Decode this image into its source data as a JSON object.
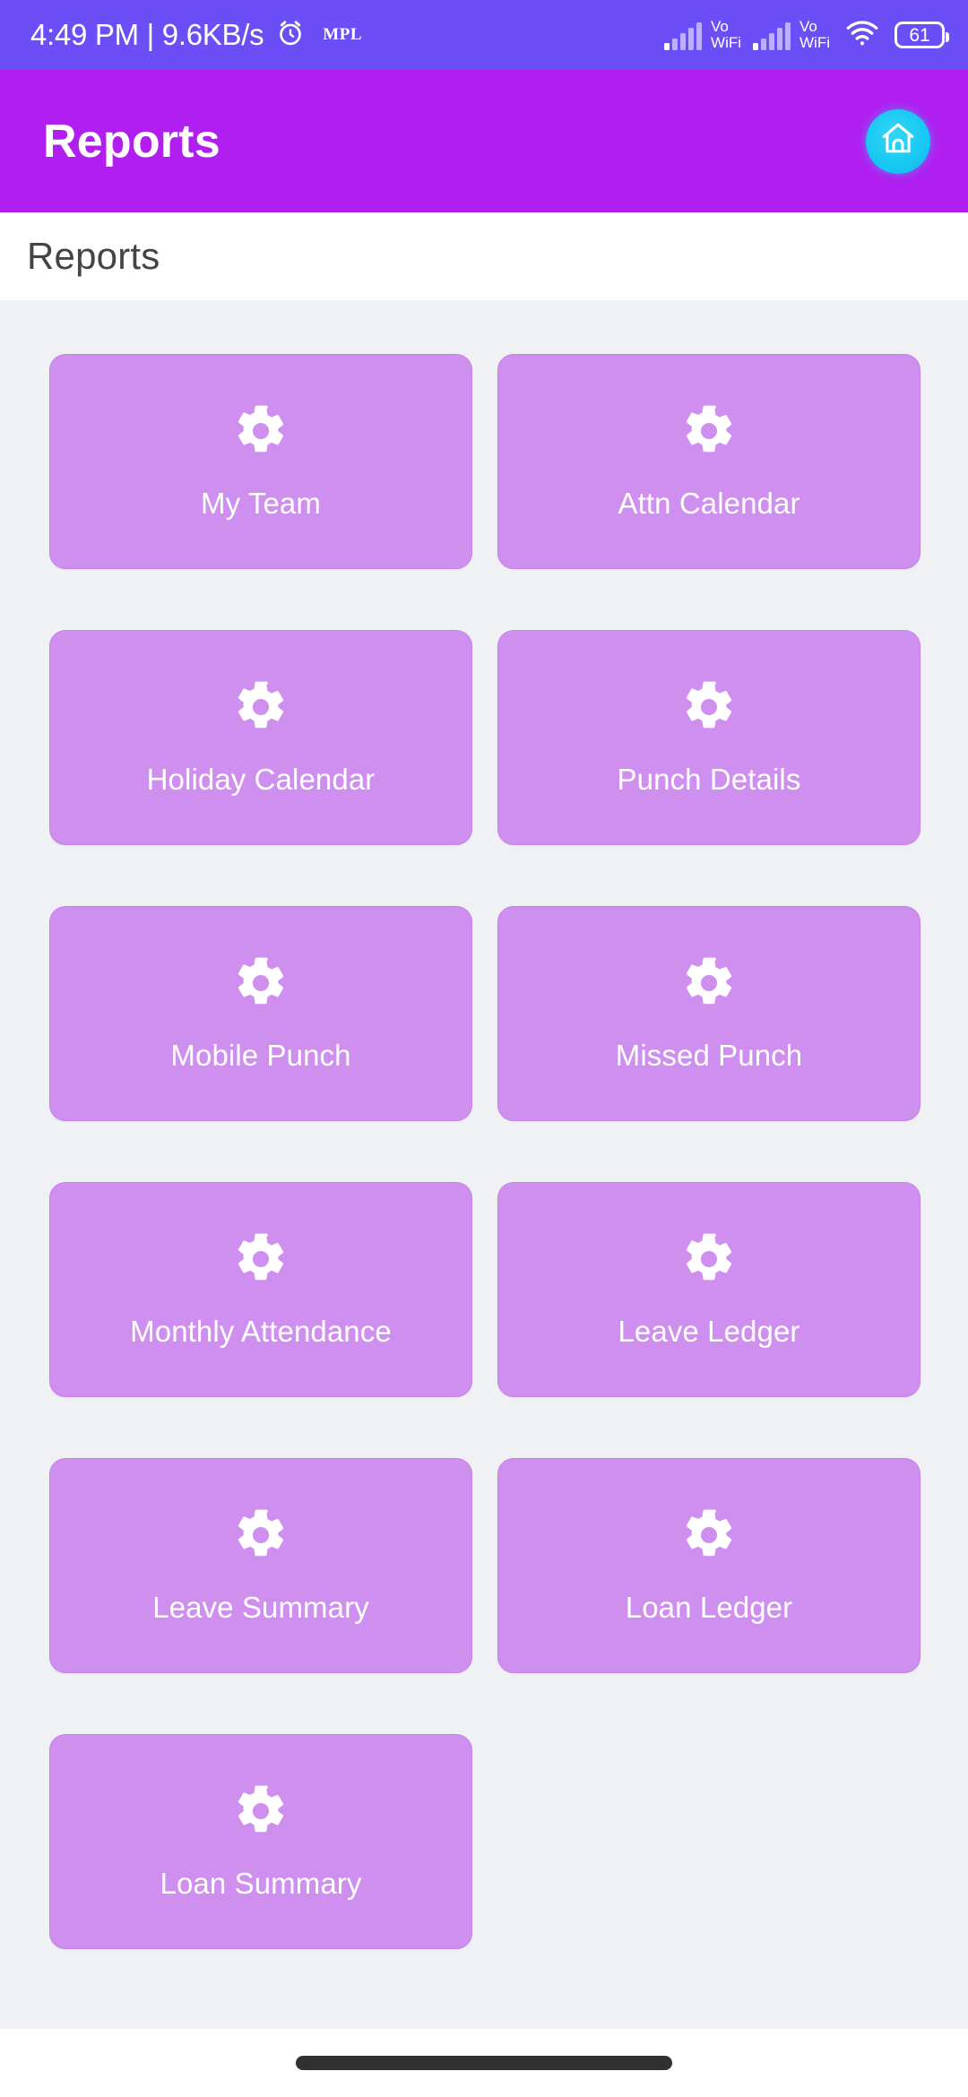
{
  "status_bar": {
    "clock": "4:49 PM | 9.6KB/s",
    "alarm_icon": "alarm-clock-icon",
    "app_badge": "MPL",
    "signal_1": "signal-bars-icon",
    "volte_1_line1": "Vo",
    "volte_1_line2": "WiFi",
    "signal_2": "signal-bars-icon",
    "volte_2_line1": "Vo",
    "volte_2_line2": "WiFi",
    "wifi_icon": "wifi-icon",
    "battery_level": "61",
    "background_color": "#6b4ef5"
  },
  "app_bar": {
    "title": "Reports",
    "home_icon": "home-icon",
    "background_color": "#b01ff0",
    "home_button_color": "#18c9f2"
  },
  "section": {
    "title": "Reports"
  },
  "theme": {
    "card_background": "#cf8fee",
    "card_border": "#c484e6",
    "page_background": "#eff1f5",
    "card_text": "#ffffff"
  },
  "grid": {
    "icon_name": "gear-icon",
    "cards": [
      {
        "label": "My Team"
      },
      {
        "label": "Attn Calendar"
      },
      {
        "label": "Holiday Calendar"
      },
      {
        "label": "Punch Details"
      },
      {
        "label": "Mobile Punch"
      },
      {
        "label": "Missed Punch"
      },
      {
        "label": "Monthly Attendance"
      },
      {
        "label": "Leave Ledger"
      },
      {
        "label": "Leave Summary"
      },
      {
        "label": "Loan Ledger"
      },
      {
        "label": "Loan Summary"
      }
    ]
  },
  "nav_bar": {
    "home_indicator": "home-indicator-pill"
  }
}
